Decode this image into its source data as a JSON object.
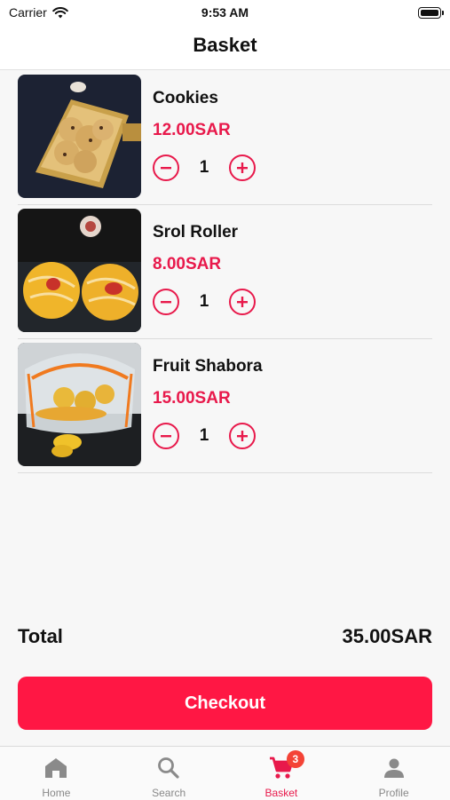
{
  "status_bar": {
    "carrier": "Carrier",
    "time": "9:53 AM"
  },
  "header": {
    "title": "Basket"
  },
  "basket": {
    "items": [
      {
        "name": "Cookies",
        "price": "12.00SAR",
        "quantity": "1"
      },
      {
        "name": "Srol Roller",
        "price": "8.00SAR",
        "quantity": "1"
      },
      {
        "name": "Fruit Shabora",
        "price": "15.00SAR",
        "quantity": "1"
      }
    ]
  },
  "summary": {
    "total_label": "Total",
    "total_value": "35.00SAR"
  },
  "checkout_label": "Checkout",
  "tabs": [
    {
      "label": "Home",
      "icon": "home-icon"
    },
    {
      "label": "Search",
      "icon": "search-icon"
    },
    {
      "label": "Basket",
      "icon": "cart-icon",
      "badge": "3",
      "active": true
    },
    {
      "label": "Profile",
      "icon": "person-icon"
    }
  ],
  "colors": {
    "accent": "#e8194b",
    "button": "#ff1744",
    "badge": "#f44336"
  }
}
